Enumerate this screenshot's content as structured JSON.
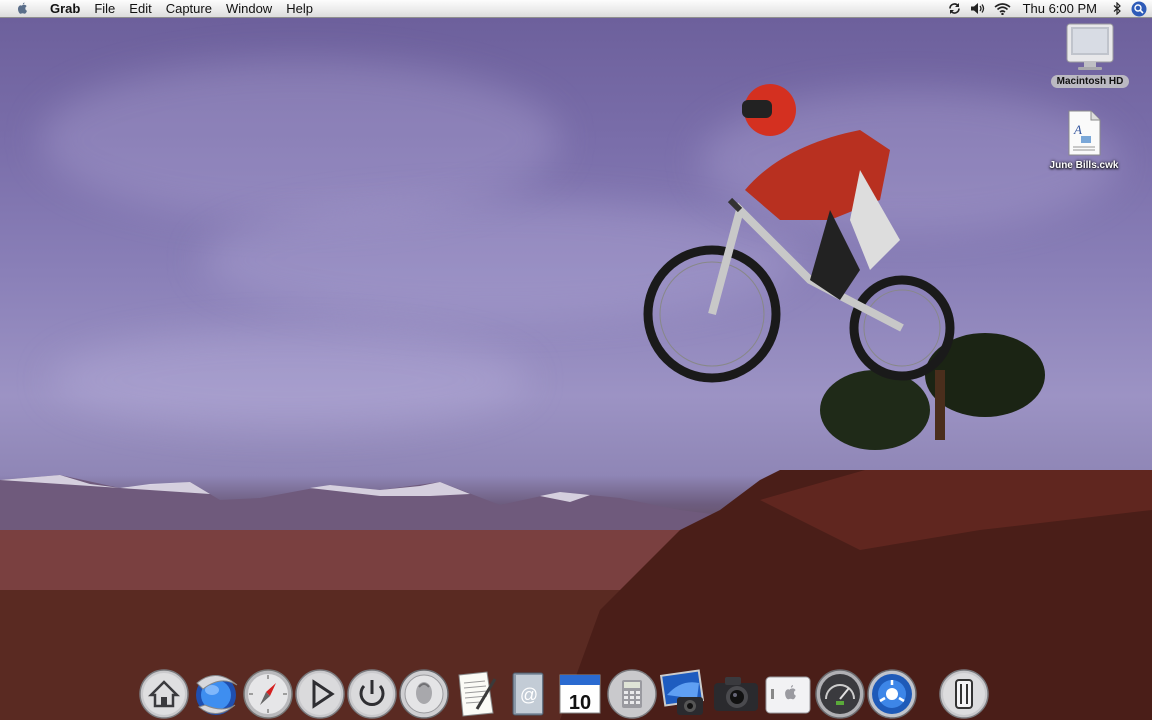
{
  "menubar": {
    "apple_icon": "apple-logo-icon",
    "app_name": "Grab",
    "menus": [
      "File",
      "Edit",
      "Capture",
      "Window",
      "Help"
    ],
    "status_icons": [
      "sync-icon",
      "volume-icon",
      "wifi-icon"
    ],
    "clock": "Thu 6:00 PM",
    "bluetooth_icon": "bluetooth-icon",
    "spotlight_icon": "spotlight-search-icon"
  },
  "desktop": {
    "wallpaper": "mountain-bike-jump",
    "icons": [
      {
        "label": "Macintosh HD",
        "icon": "hard-drive-icon",
        "selected": true
      },
      {
        "label": "June Bills.cwk",
        "icon": "document-icon",
        "selected": false
      }
    ]
  },
  "dock": {
    "items": [
      {
        "icon": "home-icon",
        "running": true
      },
      {
        "icon": "globe-browser-icon",
        "running": true
      },
      {
        "icon": "compass-safari-icon",
        "running": false
      },
      {
        "icon": "play-icon",
        "running": false
      },
      {
        "icon": "power-icon",
        "running": false
      },
      {
        "icon": "quarter-dollar-icon",
        "running": false
      },
      {
        "icon": "text-edit-icon",
        "running": false
      },
      {
        "icon": "address-book-icon",
        "running": false
      },
      {
        "icon": "calendar-icon",
        "running": false,
        "badge": "10"
      },
      {
        "icon": "calculator-icon",
        "running": false
      },
      {
        "icon": "iphoto-icon",
        "running": false
      },
      {
        "icon": "camera-icon",
        "running": false
      },
      {
        "icon": "apple-finder-icon",
        "running": false
      },
      {
        "icon": "speedometer-icon",
        "running": false
      },
      {
        "icon": "network-icon",
        "running": false
      },
      {
        "icon": "trash-icon",
        "running": false
      }
    ]
  }
}
